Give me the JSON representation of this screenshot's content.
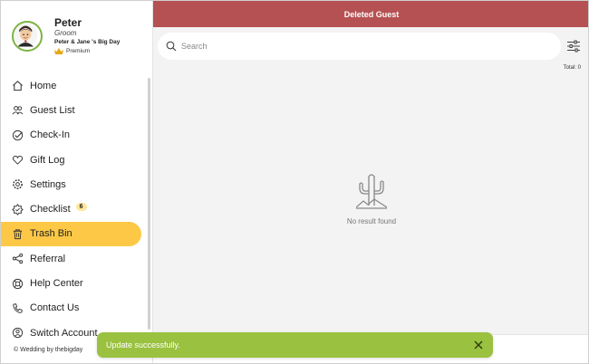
{
  "profile": {
    "name": "Peter",
    "role": "Groom",
    "event": "Peter & Jane 's Big Day",
    "plan": "Premium"
  },
  "menu": [
    {
      "label": "Home",
      "icon": "home-icon"
    },
    {
      "label": "Guest List",
      "icon": "guests-icon"
    },
    {
      "label": "Check-In",
      "icon": "check-in-icon"
    },
    {
      "label": "Gift Log",
      "icon": "heart-icon"
    },
    {
      "label": "Settings",
      "icon": "gear-icon"
    },
    {
      "label": "Checklist",
      "icon": "badge-icon",
      "badge": "6"
    },
    {
      "label": "Trash Bin",
      "icon": "trash-icon",
      "active": true
    },
    {
      "label": "Referral",
      "icon": "share-icon"
    },
    {
      "label": "Help Center",
      "icon": "lifebuoy-icon"
    },
    {
      "label": "Contact Us",
      "icon": "contact-icon"
    },
    {
      "label": "Switch Account",
      "icon": "switch-icon"
    }
  ],
  "footer": "© Wedding by thebigday",
  "header": {
    "title": "Deleted Guest"
  },
  "search": {
    "placeholder": "Search"
  },
  "total": "Total: 0",
  "empty": {
    "text": "No result found"
  },
  "toast": {
    "message": "Update successfully."
  },
  "colors": {
    "header": "#b55152",
    "active_menu": "#fcc846",
    "toast": "#9ac13f",
    "main_bg": "#f3f3f3"
  }
}
